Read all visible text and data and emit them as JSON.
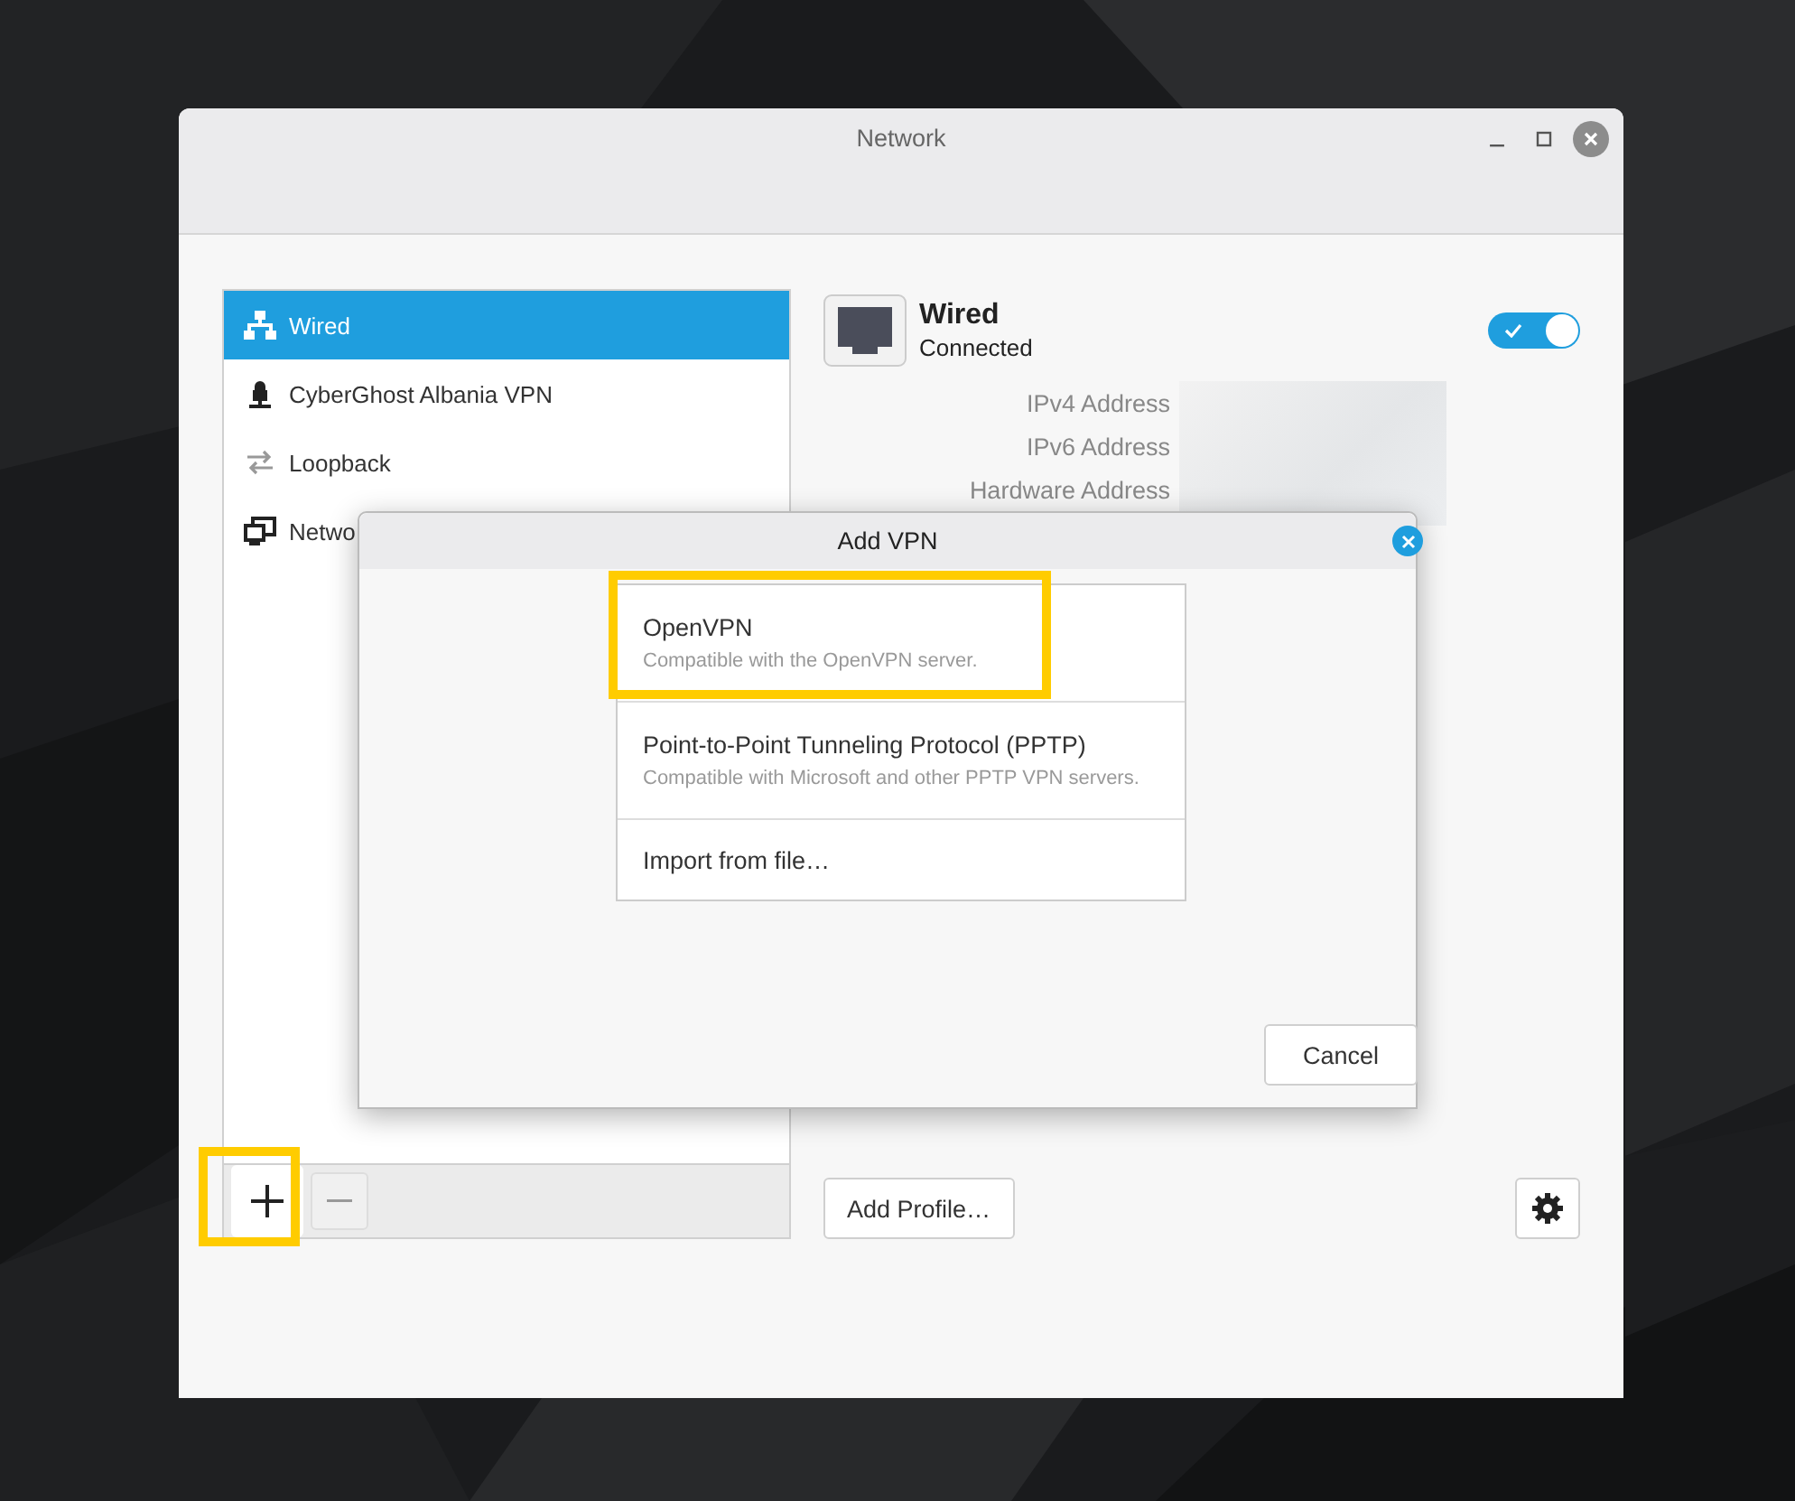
{
  "window": {
    "title": "Network"
  },
  "sidebar": {
    "items": [
      {
        "label": "Wired",
        "kind": "wired",
        "selected": true
      },
      {
        "label": "CyberGhost Albania VPN",
        "kind": "vpn",
        "selected": false
      },
      {
        "label": "Loopback",
        "kind": "loopback",
        "selected": false
      },
      {
        "label": "Netwo",
        "kind": "network",
        "selected": false
      }
    ]
  },
  "detail": {
    "title": "Wired",
    "status": "Connected",
    "enabled": true,
    "properties": [
      {
        "label": "IPv4 Address"
      },
      {
        "label": "IPv6 Address"
      },
      {
        "label": "Hardware Address"
      }
    ],
    "add_profile": "Add Profile…"
  },
  "dialog": {
    "title": "Add VPN",
    "options": [
      {
        "title": "OpenVPN",
        "description": "Compatible with the OpenVPN server."
      },
      {
        "title": "Point-to-Point Tunneling Protocol (PPTP)",
        "description": "Compatible with Microsoft and other PPTP VPN servers."
      },
      {
        "title": "Import from file…"
      }
    ],
    "cancel": "Cancel"
  }
}
